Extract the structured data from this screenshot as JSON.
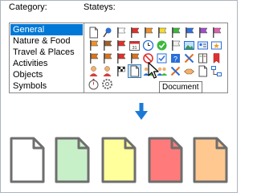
{
  "category_label": "Category:",
  "states_label": "Stateys:",
  "categories": [
    {
      "label": "General",
      "selected": true
    },
    {
      "label": "Nature & Food",
      "selected": false
    },
    {
      "label": "Travel & Places",
      "selected": false
    },
    {
      "label": "Activities",
      "selected": false
    },
    {
      "label": "Objects",
      "selected": false
    },
    {
      "label": "Symbols",
      "selected": false
    }
  ],
  "tooltip": "Document",
  "icon_rows": [
    [
      "document-icon",
      "pin-icon",
      "white-flag-icon",
      "red-flag-icon",
      "orange-flag-icon",
      "yellow-flag-icon",
      "green-flag-icon",
      "blue-flag-icon",
      "purple-flag-icon",
      "pink-flag-icon"
    ],
    [
      "orange-flag-icon",
      "brown-flag-icon",
      "red-flag-icon",
      "calendar-icon",
      "clock-icon",
      "checkmark-icon",
      "empty-flag-icon",
      "image-icon",
      "contact-card-icon",
      "star-card-icon"
    ],
    [
      "flag-icon",
      "flag-icon",
      "red-flag-icon",
      "flag-icon",
      "blocked-icon",
      "checkbox-icon",
      "question-icon",
      "tools-icon",
      "book-icon",
      "bookmark-icon"
    ],
    [
      "person-icon",
      "person-icon",
      "racing-flag-icon",
      "document-icon",
      "people-icon",
      "people-icon",
      "tools-icon",
      "handshake-icon",
      "document-icon",
      "diagram-icon"
    ],
    [
      "stopwatch-icon",
      "settings-icon"
    ]
  ],
  "big_document_colors": [
    "#ffffff",
    "#c8f0c8",
    "#ffff9c",
    "#ff7a7a",
    "#ffc890"
  ],
  "accent_color": "#0078d7"
}
